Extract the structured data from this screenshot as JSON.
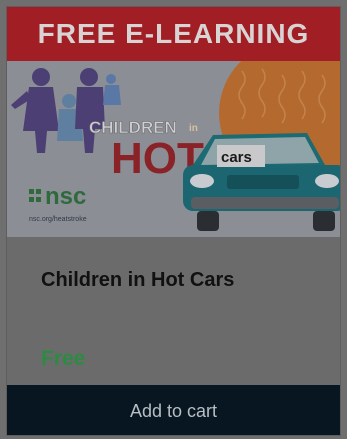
{
  "banner": {
    "text": "FREE E-LEARNING"
  },
  "hero": {
    "logo_text": "nsc",
    "logo_url_text": "nsc.org/heatstroke",
    "graphic_word_1": "CHILDREN",
    "graphic_word_2": "in",
    "graphic_word_3": "HOT",
    "graphic_word_4": "cars"
  },
  "product": {
    "title": "Children in Hot Cars",
    "price": "Free"
  },
  "actions": {
    "add_to_cart": "Add to cart"
  },
  "colors": {
    "banner": "#a21e25",
    "price": "#2b8b43",
    "button": "#071621",
    "car": "#1c6a72",
    "sun": "#b96a2a"
  }
}
